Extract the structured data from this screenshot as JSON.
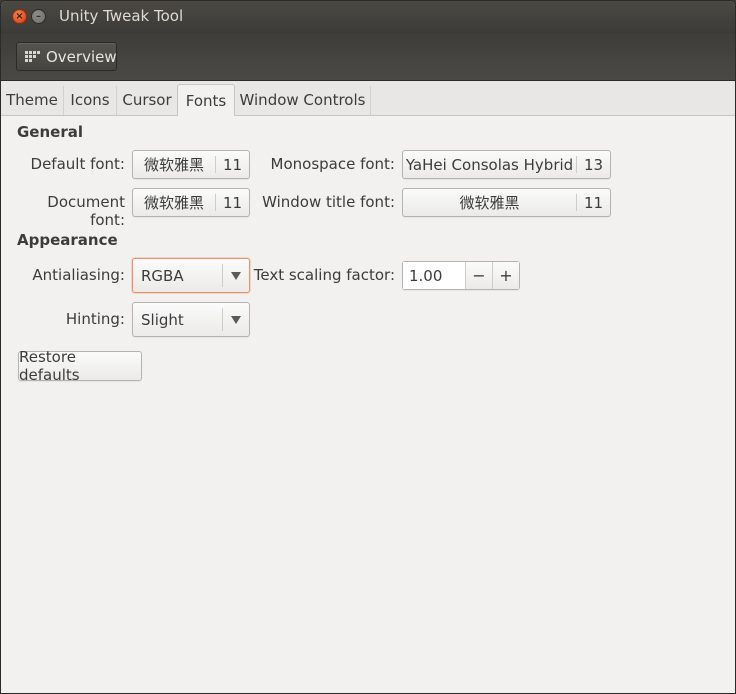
{
  "window": {
    "title": "Unity Tweak Tool"
  },
  "toolbar": {
    "overview_label": "Overview"
  },
  "tabs": [
    {
      "label": "Theme",
      "active": false
    },
    {
      "label": "Icons",
      "active": false
    },
    {
      "label": "Cursor",
      "active": false
    },
    {
      "label": "Fonts",
      "active": true
    },
    {
      "label": "Window Controls",
      "active": false
    }
  ],
  "general": {
    "heading": "General",
    "default_font": {
      "label": "Default font:",
      "name": "微软雅黑",
      "size": "11"
    },
    "monospace_font": {
      "label": "Monospace font:",
      "name": "YaHei Consolas Hybrid",
      "size": "13"
    },
    "document_font": {
      "label": "Document font:",
      "name": "微软雅黑",
      "size": "11"
    },
    "window_title_font": {
      "label": "Window title font:",
      "name": "微软雅黑",
      "size": "11"
    }
  },
  "appearance": {
    "heading": "Appearance",
    "antialiasing": {
      "label": "Antialiasing:",
      "value": "RGBA"
    },
    "text_scaling": {
      "label": "Text scaling factor:",
      "value": "1.00",
      "minus": "−",
      "plus": "+"
    },
    "hinting": {
      "label": "Hinting:",
      "value": "Slight"
    }
  },
  "restore_defaults_label": "Restore defaults",
  "colors": {
    "titlebar": "#3c3b37",
    "close_button": "#e0531d",
    "content_bg": "#f2f1f0",
    "focus_border": "#e7926c"
  }
}
